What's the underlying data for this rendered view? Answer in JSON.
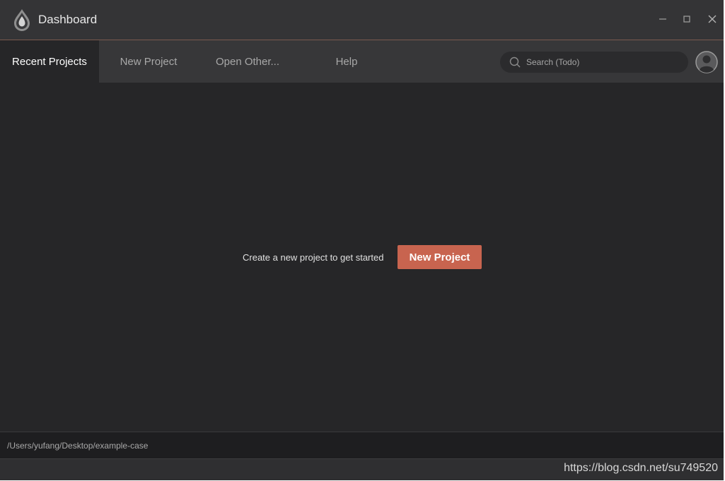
{
  "window": {
    "title": "Dashboard",
    "controls": {
      "minimize_icon": "minimize-icon",
      "maximize_icon": "maximize-icon",
      "close_icon": "close-icon"
    },
    "accent_color": "#c8644f"
  },
  "nav": {
    "tabs": [
      {
        "label": "Recent Projects",
        "active": true
      },
      {
        "label": "New Project",
        "active": false
      },
      {
        "label": "Open Other...",
        "active": false
      },
      {
        "label": "Help",
        "active": false
      }
    ],
    "search": {
      "placeholder": "Search (Todo)",
      "value": "",
      "icon": "search-icon"
    },
    "avatar_icon": "user-avatar-icon"
  },
  "main": {
    "empty_message": "Create a new project to get started",
    "new_project_button": "New Project"
  },
  "pathbar": {
    "path": "/Users/yufang/Desktop/example-case"
  },
  "footer": {
    "watermark": "https://blog.csdn.net/su749520"
  }
}
